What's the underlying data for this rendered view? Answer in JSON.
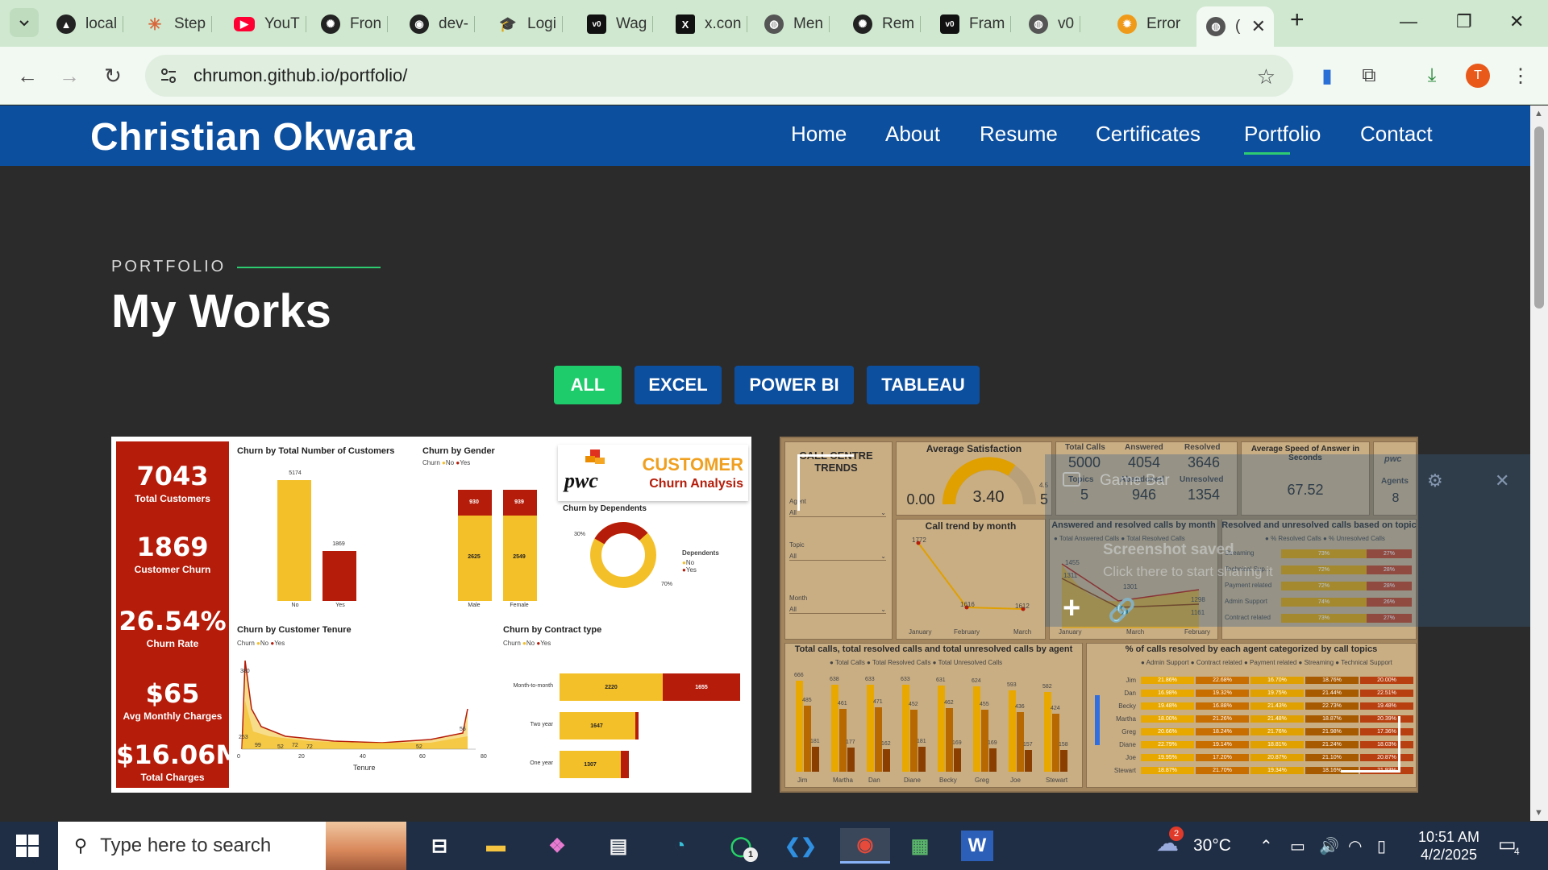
{
  "browser": {
    "tabs": [
      {
        "label": "local",
        "icon": "triangle-icon"
      },
      {
        "label": "Step",
        "icon": "asterisk-icon"
      },
      {
        "label": "YouT",
        "icon": "youtube-icon"
      },
      {
        "label": "Fron",
        "icon": "openai-icon"
      },
      {
        "label": "dev-",
        "icon": "github-icon"
      },
      {
        "label": "Logi",
        "icon": "graduation-cap-icon"
      },
      {
        "label": "Wag",
        "icon": "v0-icon"
      },
      {
        "label": "x.con",
        "icon": "x-icon"
      },
      {
        "label": "Men",
        "icon": "globe-icon"
      },
      {
        "label": "Rem",
        "icon": "openai-icon"
      },
      {
        "label": "Fram",
        "icon": "v0-icon"
      },
      {
        "label": "v0",
        "icon": "globe-icon"
      },
      {
        "label": "Error",
        "icon": "gear-orange-icon"
      },
      {
        "label": "(",
        "icon": "globe-icon"
      }
    ],
    "new_tab": "+",
    "url": "chrumon.github.io/portfolio/",
    "profile_initial": "T"
  },
  "site": {
    "brand": "Christian Okwara",
    "nav": [
      "Home",
      "About",
      "Resume",
      "Certificates",
      "Portfolio",
      "Contact"
    ],
    "active_nav": "Portfolio",
    "section_label": "PORTFOLIO",
    "section_title": "My Works",
    "filters": [
      "ALL",
      "EXCEL",
      "POWER BI",
      "TABLEAU"
    ],
    "active_filter": "ALL"
  },
  "card1": {
    "kpis": [
      {
        "value": "7043",
        "label": "Total Customers"
      },
      {
        "value": "1869",
        "label": "Customer Churn"
      },
      {
        "value": "26.54%",
        "label": "Churn Rate"
      },
      {
        "value": "$65",
        "label": "Avg Monthly Charges"
      },
      {
        "value": "$16.06M",
        "label": "Total Charges"
      }
    ],
    "logo_brand": "pwc",
    "logo_title1": "CUSTOMER",
    "logo_title2": "Churn Analysis",
    "churn_total_title": "Churn by Total Number of Customers",
    "churn_total": {
      "categories": [
        "No",
        "Yes"
      ],
      "values": [
        5174,
        1869
      ]
    },
    "gender_title": "Churn by Gender",
    "legend_churn": "Churn",
    "legend_no": "No",
    "legend_yes": "Yes",
    "gender": {
      "categories": [
        "Male",
        "Female"
      ],
      "no": [
        2625,
        2549
      ],
      "yes": [
        930,
        939
      ]
    },
    "dependents_title": "Churn by Dependents",
    "dependents_legend": "Dependents",
    "dependents": {
      "no": "70%",
      "yes": "30%"
    },
    "tenure_title": "Churn by Customer Tenure",
    "tenure_xlabel": "Tenure",
    "tenure_ticks": [
      "0",
      "20",
      "40",
      "60",
      "80"
    ],
    "tenure_labels": [
      "380",
      "253",
      "99",
      "52",
      "72",
      "72",
      "52",
      "56"
    ],
    "contract_title": "Churn by Contract type",
    "contract": [
      {
        "label": "Month-to-month",
        "no": 2220,
        "yes": 1655
      },
      {
        "label": "Two year",
        "no": 1647,
        "yes": 48
      },
      {
        "label": "One year",
        "no": 1307,
        "yes": 166
      }
    ]
  },
  "card2": {
    "title": "CALL CENTRE TRENDS",
    "filters": [
      {
        "label": "Agent",
        "value": "All"
      },
      {
        "label": "Topic",
        "value": "All"
      },
      {
        "label": "Month",
        "value": "All"
      }
    ],
    "avg_satisfaction_title": "Average Satisfaction",
    "avg_satisfaction": "3.40",
    "gauge_min": "0.00",
    "gauge_max": "5",
    "gauge_target": "4.5",
    "kpis": [
      {
        "label": "Total Calls",
        "value": "5000"
      },
      {
        "label": "Answered",
        "value": "4054"
      },
      {
        "label": "Resolved",
        "value": "3646"
      },
      {
        "label": "Topics",
        "value": "5"
      },
      {
        "label": "Abandoned",
        "value": "946"
      },
      {
        "label": "Unresolved",
        "value": "1354"
      }
    ],
    "speed_title": "Average Speed of Answer in Seconds",
    "speed": "67.52",
    "agents_label": "Agents",
    "agents": "8",
    "trend_title": "Call trend by month",
    "trend_months": [
      "January",
      "February",
      "March"
    ],
    "trend_values": [
      "1772",
      "1616",
      "1612"
    ],
    "answered_title": "Answered and resolved calls by month",
    "answered_legend": [
      "Total Answered Calls",
      "Total Resolved Calls"
    ],
    "answered_values": [
      "1455",
      "1311",
      "1301",
      "1298",
      "1161"
    ],
    "topic_title": "Resolved and unresolved calls based on topic",
    "topic_legend": [
      "% Resolved Calls",
      "% Unresolved Calls"
    ],
    "topics": [
      {
        "name": "Streaming",
        "res": "73%",
        "unres": "27%"
      },
      {
        "name": "Technical Sup...",
        "res": "72%",
        "unres": "28%"
      },
      {
        "name": "Payment related",
        "res": "72%",
        "unres": "28%"
      },
      {
        "name": "Admin Support",
        "res": "74%",
        "res_note": "",
        "unres": "26%"
      },
      {
        "name": "Contract related",
        "res": "73%",
        "unres": "27%"
      }
    ],
    "agent_title": "Total calls, total resolved calls and total unresolved calls by agent",
    "agent_legend": [
      "Total Calls",
      "Total Resolved Calls",
      "Total Unresolved Calls"
    ],
    "agents_list": [
      "Jim",
      "Martha",
      "Dan",
      "Diane",
      "Becky",
      "Greg",
      "Joe",
      "Stewart"
    ],
    "agent_totals": [
      "666",
      "638",
      "633",
      "633",
      "631",
      "624",
      "593",
      "582"
    ],
    "agent_resolved": [
      "485",
      "461",
      "471",
      "452",
      "462",
      "455",
      "436",
      "424"
    ],
    "agent_unresolved": [
      "181",
      "177",
      "162",
      "181",
      "169",
      "169",
      "157",
      "158"
    ],
    "pct_title": "% of calls resolved by each agent categorized by call topics",
    "pct_legend": [
      "Admin Support",
      "Contract related",
      "Payment related",
      "Streaming",
      "Technical Support"
    ],
    "pct_rows": [
      {
        "agent": "Jim",
        "vals": [
          "21.86%",
          "22.68%",
          "16.70%",
          "18.76%",
          "20.00%"
        ]
      },
      {
        "agent": "Dan",
        "vals": [
          "16.98%",
          "19.32%",
          "19.75%",
          "21.44%",
          "22.51%"
        ]
      },
      {
        "agent": "Becky",
        "vals": [
          "19.48%",
          "16.88%",
          "21.43%",
          "22.73%",
          "19.48%"
        ]
      },
      {
        "agent": "Martha",
        "vals": [
          "18.00%",
          "21.26%",
          "21.48%",
          "18.87%",
          "20.39%"
        ]
      },
      {
        "agent": "Greg",
        "vals": [
          "20.66%",
          "18.24%",
          "21.76%",
          "21.98%",
          "17.36%"
        ]
      },
      {
        "agent": "Diane",
        "vals": [
          "22.79%",
          "19.14%",
          "18.81%",
          "21.24%",
          "18.03%"
        ]
      },
      {
        "agent": "Joe",
        "vals": [
          "19.95%",
          "17.20%",
          "20.87%",
          "21.10%",
          "20.87%"
        ]
      },
      {
        "agent": "Stewart",
        "vals": [
          "18.87%",
          "21.70%",
          "19.34%",
          "18.16%",
          "21.93%"
        ]
      }
    ]
  },
  "gamebar": {
    "title": "Game Bar",
    "message1": "Screenshot saved",
    "message2": "Click there to start sharing it"
  },
  "taskbar": {
    "search_placeholder": "Type here to search",
    "weather_temp": "30°C",
    "weather_badge": "2",
    "whatsapp_badge": "1",
    "notification_count": "4",
    "time": "10:51 AM",
    "date": "4/2/2025"
  },
  "colors": {
    "brand_blue": "#0d4f9f",
    "accent_green": "#2ecc71",
    "churn_red": "#b51c0a",
    "churn_yellow": "#f4c02a"
  }
}
